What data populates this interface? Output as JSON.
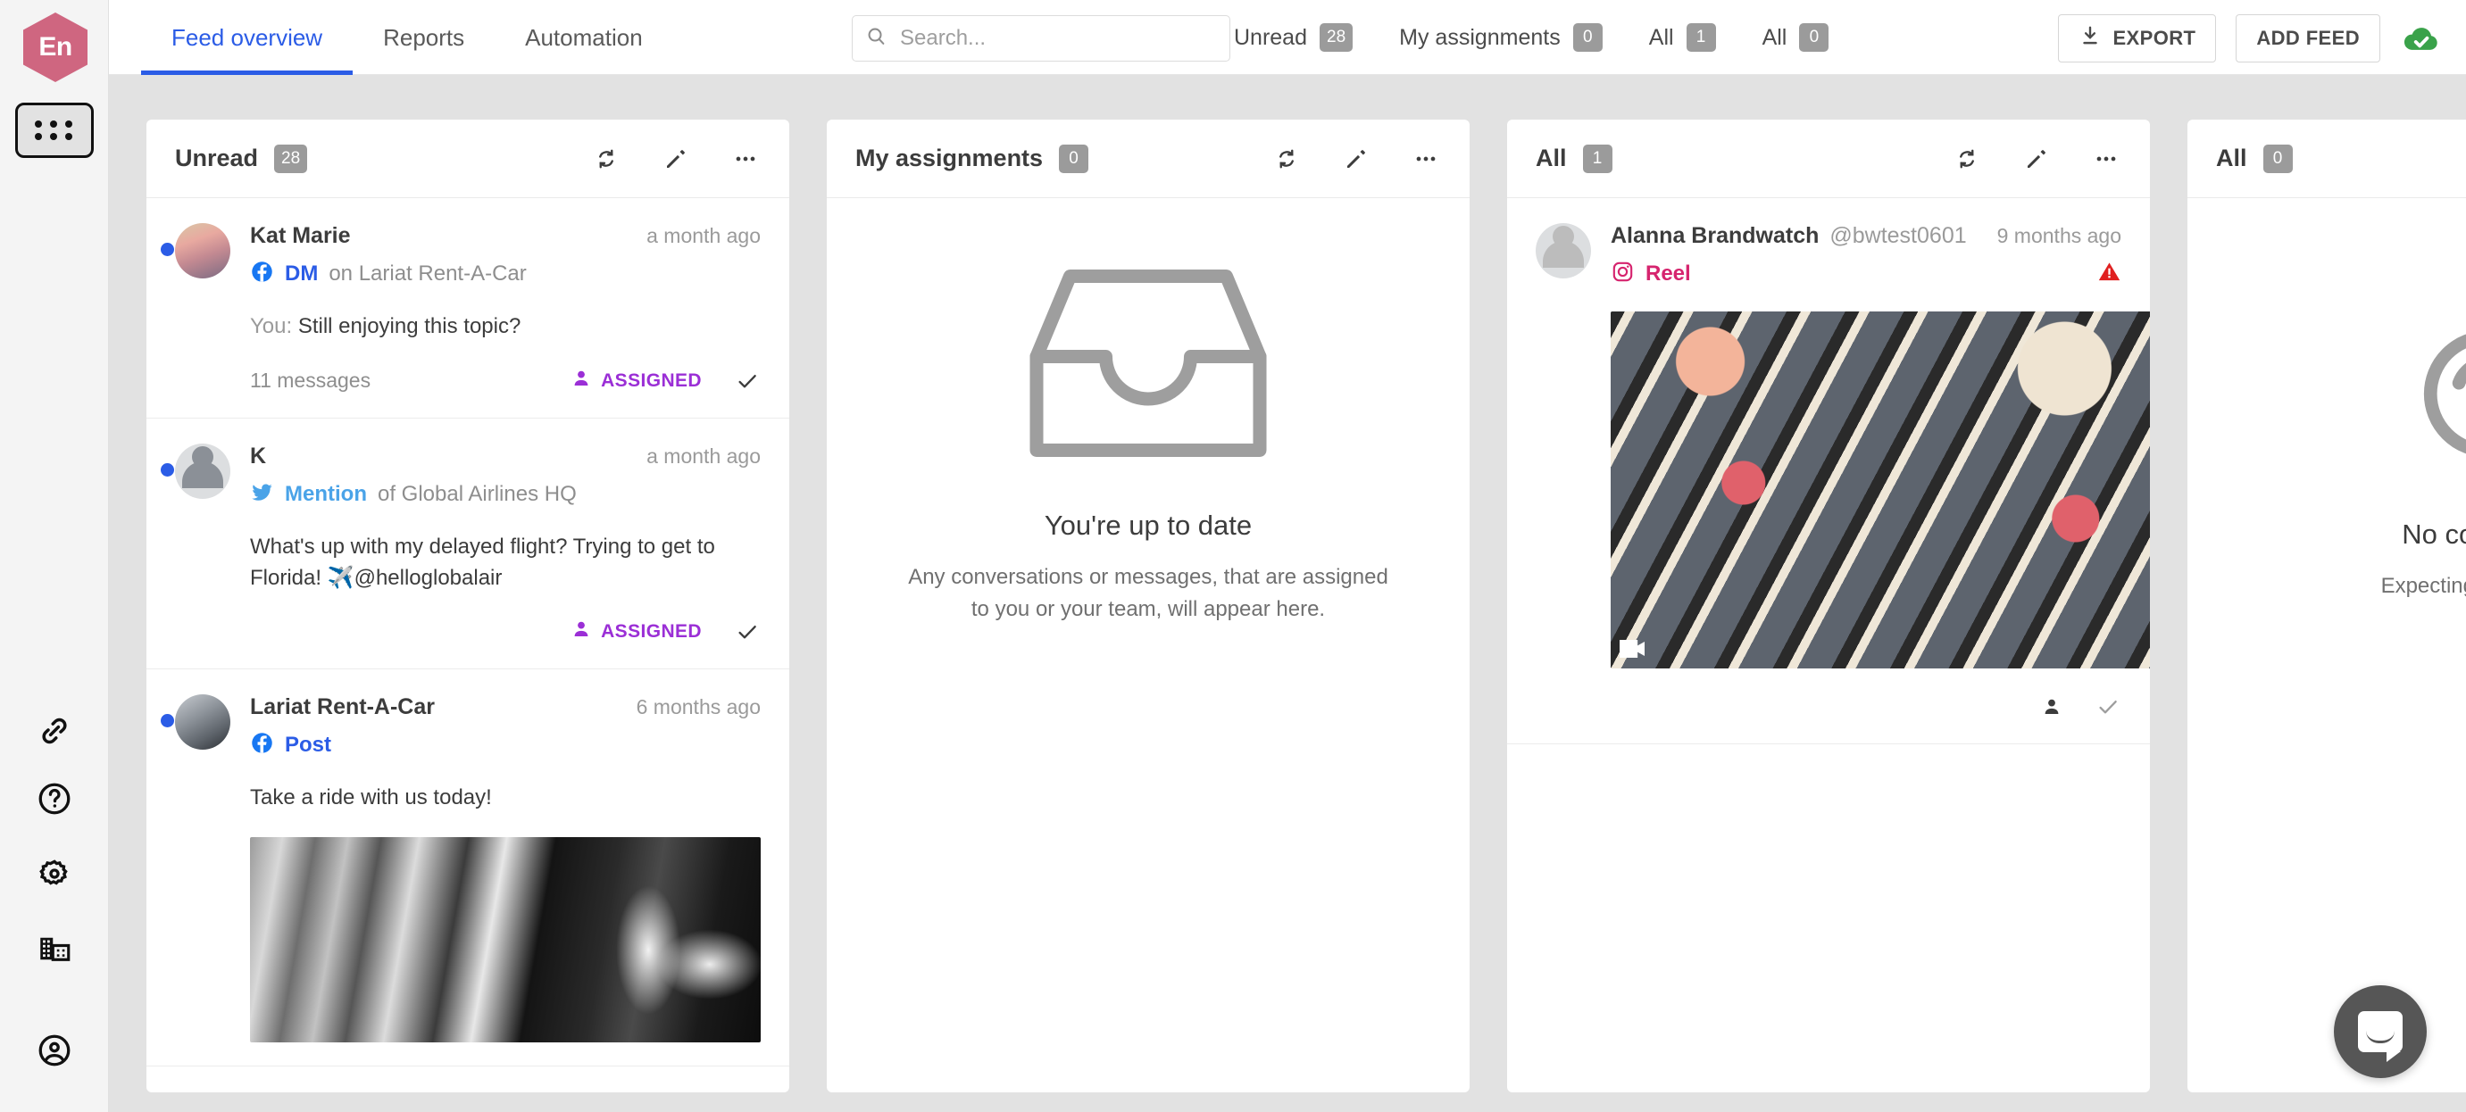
{
  "brand": {
    "logo_text": "En",
    "logo_color": "#cf6680"
  },
  "sidebar": {
    "apps_label": "apps-grid",
    "items": [
      {
        "icon": "link-icon",
        "name": "integrations"
      },
      {
        "icon": "help-circle-icon",
        "name": "help"
      },
      {
        "icon": "gear-icon",
        "name": "settings"
      },
      {
        "icon": "building-icon",
        "name": "organization"
      },
      {
        "icon": "account-circle-icon",
        "name": "account"
      }
    ]
  },
  "topbar": {
    "tabs": [
      {
        "label": "Feed overview",
        "active": true
      },
      {
        "label": "Reports",
        "active": false
      },
      {
        "label": "Automation",
        "active": false
      }
    ],
    "search": {
      "placeholder": "Search...",
      "value": ""
    },
    "filters": [
      {
        "label": "Unread",
        "count": "28"
      },
      {
        "label": "My assignments",
        "count": "0"
      },
      {
        "label": "All",
        "count": "1"
      },
      {
        "label": "All",
        "count": "0"
      }
    ],
    "export_label": "EXPORT",
    "add_feed_label": "ADD FEED",
    "status_icon": "cloud-check-icon",
    "status_color": "#3aa24a"
  },
  "columns": [
    {
      "title": "Unread",
      "count": "28",
      "conversations": [
        {
          "name": "Kat Marie",
          "handle": "",
          "time": "a month ago",
          "channel": "facebook",
          "type": "DM",
          "context": "on Lariat Rent-A-Car",
          "prefix": "You:",
          "body": "Still enjoying this topic?",
          "messages": "11 messages",
          "assigned": "ASSIGNED",
          "unread": true,
          "image": "none",
          "avatar": "kat"
        },
        {
          "name": "K",
          "handle": "",
          "time": "a month ago",
          "channel": "twitter",
          "type": "Mention",
          "context": "of Global Airlines HQ",
          "prefix": "",
          "body": "What's up with my delayed flight? Trying to get to Florida! ✈️@helloglobalair",
          "messages": "",
          "assigned": "ASSIGNED",
          "unread": true,
          "image": "none",
          "avatar": "generic"
        },
        {
          "name": "Lariat Rent-A-Car",
          "handle": "",
          "time": "6 months ago",
          "channel": "facebook",
          "type": "Post",
          "context": "",
          "prefix": "",
          "body": "Take a ride with us today!",
          "messages": "",
          "assigned": "",
          "unread": true,
          "image": "cars",
          "avatar": "car"
        }
      ]
    },
    {
      "title": "My assignments",
      "count": "0",
      "empty": {
        "icon": "inbox-icon",
        "title": "You're up to date",
        "subtitle": "Any conversations or messages, that are assigned to you or your team, will appear here."
      },
      "conversations": []
    },
    {
      "title": "All",
      "count": "1",
      "conversations": [
        {
          "name": "Alanna Brandwatch",
          "handle": "@bwtest0601",
          "time": "9 months ago",
          "channel": "instagram",
          "type": "Reel",
          "context": "",
          "prefix": "",
          "body": "",
          "messages": "",
          "assigned": "",
          "unread": false,
          "warning": true,
          "image": "reel",
          "avatar": "generic-light"
        }
      ]
    },
    {
      "title": "All",
      "count": "0",
      "empty": {
        "icon": "no-conversations-icon",
        "title": "No conversations",
        "subtitle": "Expecting something else?"
      },
      "conversations": []
    }
  ],
  "chat_widget": {
    "icon": "intercom-chat-icon"
  }
}
